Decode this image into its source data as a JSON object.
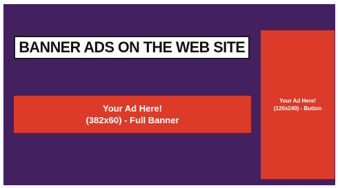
{
  "page": {
    "title": "BANNER ADS ON THE WEB SITE"
  },
  "full_banner": {
    "line1": "Your Ad Here!",
    "line2": "(382x60) - Full Banner"
  },
  "button_ad": {
    "line1": "Your Ad Here!",
    "line2": "(120x240) - Button"
  },
  "colors": {
    "background": "#432161",
    "ad_fill": "#db3b28",
    "ad_text": "#ffffff",
    "title_box": "#ffffff",
    "title_text": "#111111"
  }
}
